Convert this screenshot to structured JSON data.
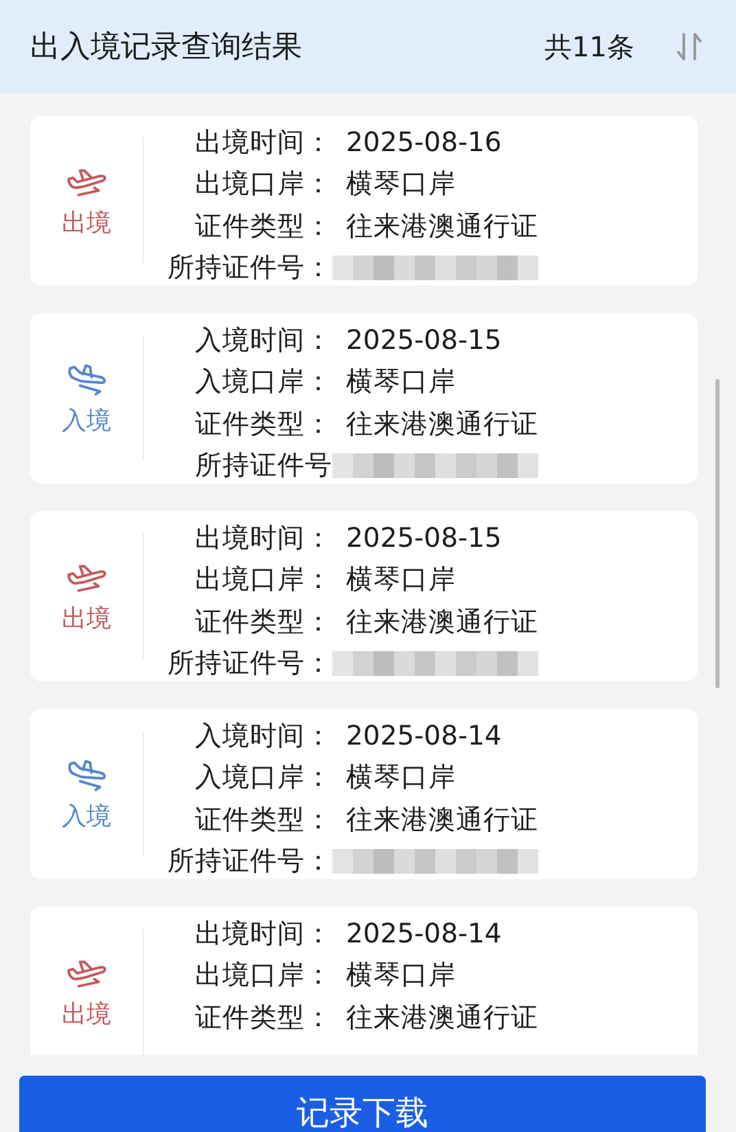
{
  "header": {
    "title": "出入境记录查询结果",
    "count": "共11条"
  },
  "records": [
    {
      "kind": "exit",
      "badge": "出境",
      "fields": [
        {
          "label": "出境时间：",
          "value": "2025-08-16"
        },
        {
          "label": "出境口岸：",
          "value": "横琴口岸"
        },
        {
          "label": "证件类型：",
          "value": "往来港澳通行证"
        },
        {
          "label": "所持证件号：",
          "kind": "blurred"
        }
      ]
    },
    {
      "kind": "entry",
      "badge": "入境",
      "fields": [
        {
          "label": "入境时间：",
          "value": "2025-08-15"
        },
        {
          "label": "入境口岸：",
          "value": "横琴口岸"
        },
        {
          "label": "证件类型：",
          "value": "往来港澳通行证"
        },
        {
          "label": "所持证件号",
          "kind": "blurred"
        }
      ]
    },
    {
      "kind": "exit",
      "badge": "出境",
      "fields": [
        {
          "label": "出境时间：",
          "value": "2025-08-15"
        },
        {
          "label": "出境口岸：",
          "value": "横琴口岸"
        },
        {
          "label": "证件类型：",
          "value": "往来港澳通行证"
        },
        {
          "label": "所持证件号：",
          "kind": "blurred"
        }
      ]
    },
    {
      "kind": "entry",
      "badge": "入境",
      "fields": [
        {
          "label": "入境时间：",
          "value": "2025-08-14"
        },
        {
          "label": "入境口岸：",
          "value": "横琴口岸"
        },
        {
          "label": "证件类型：",
          "value": "往来港澳通行证"
        },
        {
          "label": "所持证件号：",
          "kind": "blurred"
        }
      ]
    },
    {
      "kind": "exit",
      "badge": "出境",
      "fields": [
        {
          "label": "出境时间：",
          "value": "2025-08-14"
        },
        {
          "label": "出境口岸：",
          "value": "横琴口岸"
        },
        {
          "label": "证件类型：",
          "value": "往来港澳通行证"
        }
      ]
    }
  ],
  "download_button": "记录下载"
}
